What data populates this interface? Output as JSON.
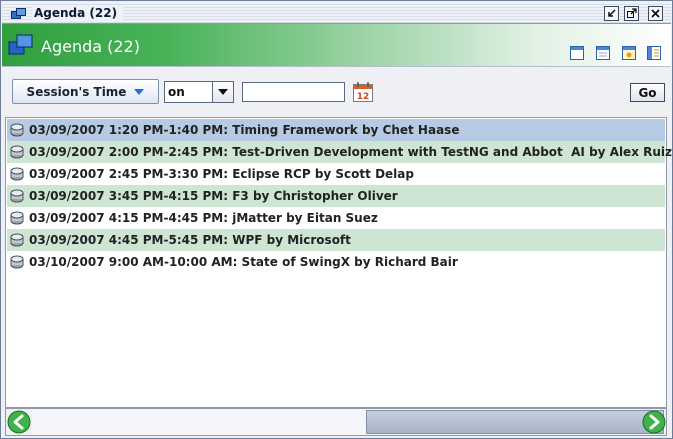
{
  "window": {
    "title": "Agenda (22)"
  },
  "header": {
    "title": "Agenda (22)",
    "view_buttons": [
      "day-view-icon",
      "week-view-icon",
      "month-view-icon",
      "list-view-icon"
    ]
  },
  "toolbar": {
    "session_button_label": "Session's Time",
    "operator_value": "on",
    "date_value": "",
    "calendar_icon_text": "12",
    "go_label": "Go"
  },
  "sessions": [
    {
      "text": "03/09/2007 1:20 PM-1:40 PM: Timing Framework by Chet Haase",
      "state": "selected"
    },
    {
      "text": "03/09/2007 2:00 PM-2:45 PM: Test-Driven Development with TestNG and Abbot  AI by Alex Ruiz",
      "state": "striped"
    },
    {
      "text": "03/09/2007 2:45 PM-3:30 PM: Eclipse RCP by Scott Delap",
      "state": "plain"
    },
    {
      "text": "03/09/2007 3:45 PM-4:15 PM: F3 by Christopher Oliver",
      "state": "striped"
    },
    {
      "text": "03/09/2007 4:15 PM-4:45 PM: jMatter by Eitan Suez",
      "state": "plain"
    },
    {
      "text": "03/09/2007 4:45 PM-5:45 PM: WPF by Microsoft",
      "state": "striped"
    },
    {
      "text": "03/10/2007 9:00 AM-10:00 AM: State of SwingX by Richard Bair",
      "state": "plain"
    }
  ],
  "colors": {
    "selected_row": "#b7cae4",
    "striped_row": "#cde5d2",
    "plain_row": "#ffffff",
    "header_green": "#2f9f3e"
  },
  "scrollbar": {
    "thumb_position_fraction": 0.55,
    "thumb_size_fraction": 0.49
  }
}
